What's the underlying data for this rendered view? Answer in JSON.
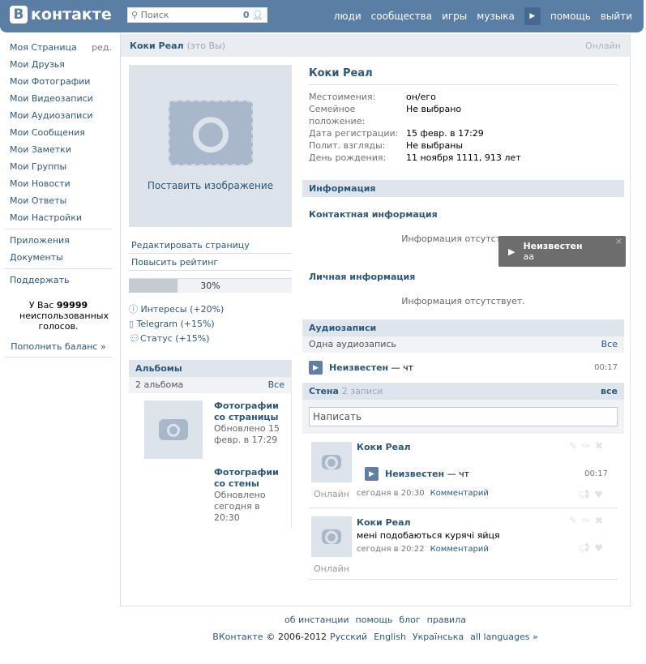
{
  "header": {
    "logo_letter": "В",
    "logo_text": "контакте",
    "search_placeholder": "Поиск",
    "search_count": "0",
    "nav": [
      "люди",
      "сообщества",
      "игры",
      "музыка",
      "помощь",
      "выйти"
    ]
  },
  "sidebar": {
    "items": [
      "Моя Страница",
      "Мои Друзья",
      "Мои Фотографии",
      "Мои Видеозаписи",
      "Мои Аудиозаписи",
      "Мои Сообщения",
      "Мои Заметки",
      "Мои Группы",
      "Мои Новости",
      "Мои Ответы",
      "Мои Настройки"
    ],
    "edit": "ред.",
    "apps": "Приложения",
    "docs": "Документы",
    "support": "Поддержать",
    "votes_pre": "У Вас",
    "votes_count": "99999",
    "votes_post": "неиспользованных голосов.",
    "topup": "Пополнить баланс »"
  },
  "profile": {
    "name": "Коки Реал",
    "me": "(это Вы)",
    "status": "Онлайн",
    "set_photo": "Поставить изображение",
    "edit_page": "Редактировать страницу",
    "raise_rating": "Повысить рейтинг",
    "rating_percent": 30,
    "rating_label": "30%",
    "bonuses": [
      "Интересы (+20%)",
      "Telegram (+15%)",
      "Статус (+15%)"
    ],
    "fields": [
      {
        "k": "Местоимения:",
        "v": "он/его"
      },
      {
        "k": "Семейное положение:",
        "v": "Не выбрано"
      },
      {
        "k": "Дата регистрации:",
        "v": "15 февр. в 17:29"
      },
      {
        "k": "Полит. взгляды:",
        "v": "Не выбраны"
      },
      {
        "k": "День рождения:",
        "v": "11 ноября 1111, 913 лет"
      }
    ]
  },
  "albums": {
    "title": "Альбомы",
    "count": "2 альбома",
    "all": "Все",
    "items": [
      {
        "title": "Фотографии со страницы",
        "updated": "Обновлено 15 февр. в 17:29"
      },
      {
        "title": "Фотографии со стены",
        "updated": "Обновлено сегодня в 20:30"
      }
    ]
  },
  "info": {
    "title": "Информация",
    "contact": "Контактная информация",
    "personal": "Личная информация",
    "empty": "Информация отсутствует."
  },
  "player_popup": {
    "artist": "Неизвестен",
    "title": "аа",
    "close": "×"
  },
  "audio": {
    "title": "Аудиозаписи",
    "count": "Одна аудиозапись",
    "all": "Все",
    "track": {
      "artist": "Неизвестен",
      "title": "— чт",
      "duration": "00:17"
    }
  },
  "wall": {
    "title": "Стена",
    "count": "2 записи",
    "all": "все",
    "placeholder": "Написать",
    "posts": [
      {
        "author": "Коки Реал",
        "online": "Онлайн",
        "track_artist": "Неизвестен",
        "track_title": "— чт",
        "duration": "00:17",
        "time": "сегодня в 20:30",
        "comment": "Комментарий"
      },
      {
        "author": "Коки Реал",
        "online": "Онлайн",
        "text": "мені подобаються курячі яйця",
        "time": "сегодня в 20:22",
        "comment": "Комментарий"
      }
    ]
  },
  "footer": {
    "links": [
      "об инстанции",
      "помощь",
      "блог",
      "правила"
    ],
    "brand": "ВКонтакте",
    "copy": "© 2006-2012",
    "langs": [
      "Русский",
      "English",
      "Українська",
      "all languages »"
    ]
  }
}
